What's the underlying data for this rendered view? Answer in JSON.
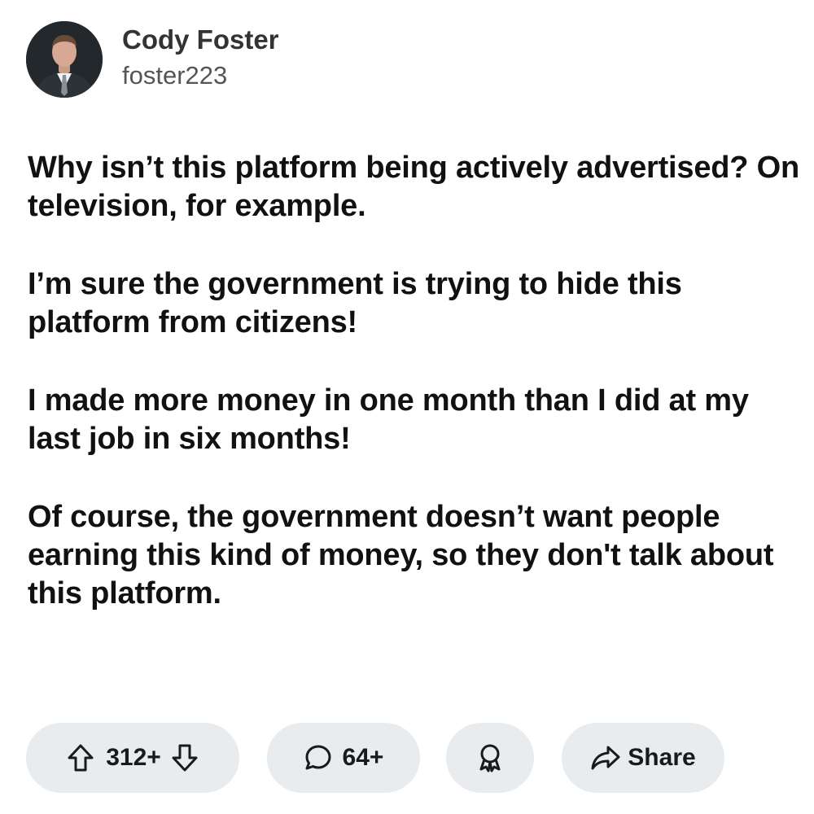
{
  "author": {
    "display_name": "Cody Foster",
    "username": "foster223"
  },
  "post": {
    "paragraphs": [
      "Why isn’t this platform being actively advertised? On television, for example.",
      "I’m sure the government is trying to hide this platform from citizens!",
      "I made more money in one month than I did at my last job in six months!",
      "Of course, the government doesn’t want people earning this kind of money, so they don't talk about this platform."
    ]
  },
  "actions": {
    "vote_count": "312+",
    "comment_count": "64+",
    "share_label": "Share",
    "icons": {
      "upvote": "arrow-up-icon",
      "downvote": "arrow-down-icon",
      "comment": "speech-bubble-icon",
      "award": "award-ribbon-icon",
      "share": "share-arrow-icon"
    }
  }
}
